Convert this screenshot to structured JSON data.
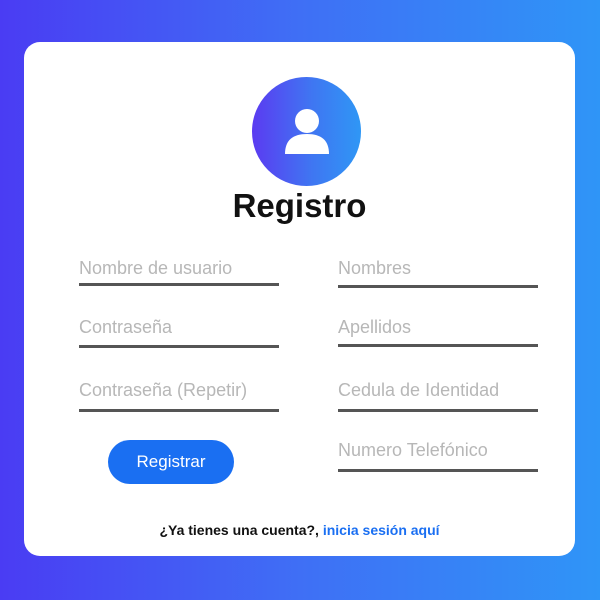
{
  "form": {
    "title": "Registro",
    "left_fields": [
      {
        "placeholder": "Nombre de usuario"
      },
      {
        "placeholder": "Contraseña"
      },
      {
        "placeholder": "Contraseña (Repetir)"
      }
    ],
    "right_fields": [
      {
        "placeholder": "Nombres"
      },
      {
        "placeholder": "Apellidos"
      },
      {
        "placeholder": "Cedula de Identidad"
      },
      {
        "placeholder": "Numero Telefónico"
      }
    ],
    "submit_label": "Registrar"
  },
  "footer": {
    "prompt": "¿Ya tienes una cuenta?,",
    "link_text": "inicia sesión aquí"
  },
  "colors": {
    "accent": "#1a6ff2",
    "background_gradient_start": "#4a3cf3",
    "background_gradient_end": "#2f95f7"
  },
  "icons": {
    "avatar": "user-icon"
  }
}
